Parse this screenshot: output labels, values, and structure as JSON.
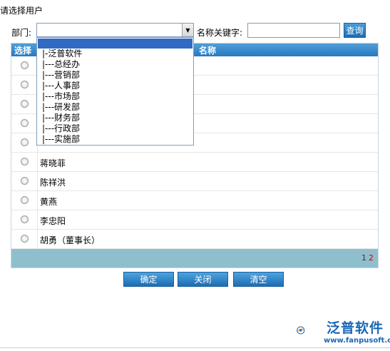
{
  "title": "请选择用户",
  "filter": {
    "dept_label": "部门:",
    "dept_value": "",
    "keyword_label": "名称关键字:",
    "keyword_value": "",
    "query_label": "查询"
  },
  "dropdown_options": [
    "|-泛普软件",
    "|---总经办",
    "|---营销部",
    "|---人事部",
    "|---市场部",
    "|---研发部",
    "|---财务部",
    "|---行政部",
    "|---实施部"
  ],
  "grid": {
    "col_select": "选择",
    "col_name": "名称",
    "rows": [
      "",
      "",
      "",
      "",
      "",
      "蒋晓菲",
      "陈祥洪",
      "黄燕",
      "李忠阳",
      "胡勇（董事长）"
    ]
  },
  "pager": {
    "page1": "1",
    "page2": "2"
  },
  "buttons": {
    "confirm": "确定",
    "close": "关闭",
    "clear": "清空"
  },
  "logo": {
    "brand": "泛普软件",
    "url": "www.fanpusoft.com"
  },
  "colors": {
    "header_blue": "#2a78c0",
    "pager_bg": "#8fbfcc",
    "brand_blue": "#1a67b5",
    "brand_orange": "#f39a1e"
  }
}
